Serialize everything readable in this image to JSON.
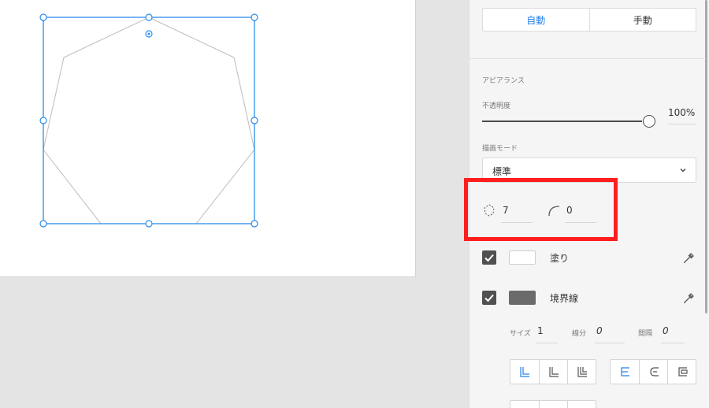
{
  "canvas": {
    "shape": {
      "type": "polygon",
      "corner_count": 7
    }
  },
  "panel": {
    "responsive_resize": {
      "auto_label": "自動",
      "manual_label": "手動",
      "selected": "auto"
    },
    "appearance": {
      "section_title": "アピアランス",
      "opacity_label": "不透明度",
      "opacity_value": "100%",
      "opacity_fraction": 1.0,
      "blend_mode_label": "描画モード",
      "blend_mode_value": "標準"
    },
    "polygon": {
      "corner_count_value": "7",
      "corner_radius_value": "0"
    },
    "fill": {
      "checked": true,
      "label": "塗り",
      "color": "#ffffff"
    },
    "border": {
      "checked": true,
      "label": "境界線",
      "color": "#6b6b6b"
    },
    "stroke_settings": {
      "size_label": "サイズ",
      "size_value": "1",
      "dash_label": "線分",
      "dash_value": "0",
      "gap_label": "間隔",
      "gap_value": "0"
    },
    "highlight_color": "#ff1e1e",
    "accent_color": "#2680eb"
  }
}
